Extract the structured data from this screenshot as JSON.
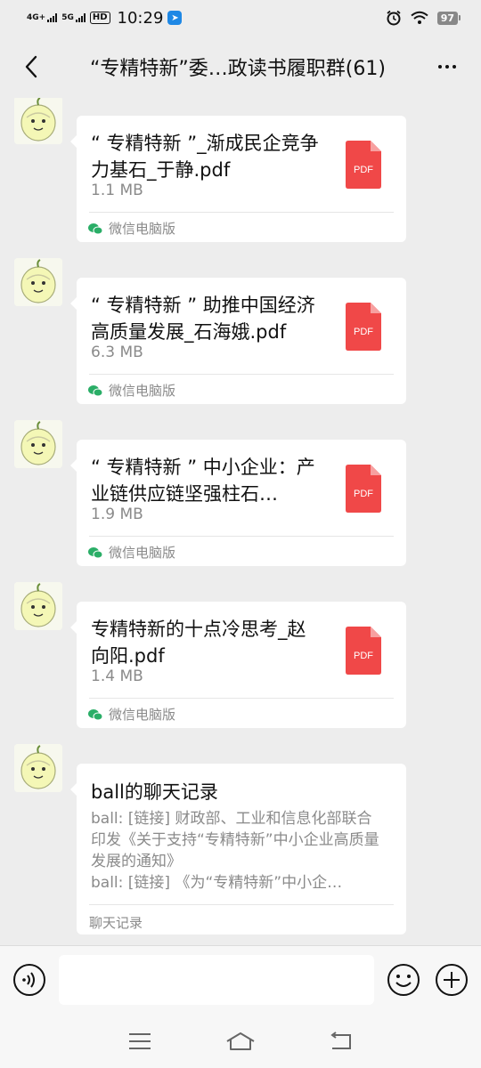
{
  "status_bar": {
    "sim1_label": "4G+",
    "sim2_label": "5G",
    "hd_label": "HD",
    "time": "10:29",
    "battery": "97"
  },
  "header": {
    "title": "“专精特新”委…政读书履职群(61)"
  },
  "messages": [
    {
      "type": "file",
      "file_name": "“ 专精特新 ”_渐成民企竞争力基石_于静.pdf",
      "file_size": "1.1 MB",
      "icon_label": "PDF",
      "source": "微信电脑版"
    },
    {
      "type": "file",
      "file_name": "“ 专精特新 ” 助推中国经济高质量发展_石海娥.pdf",
      "file_size": "6.3 MB",
      "icon_label": "PDF",
      "source": "微信电脑版"
    },
    {
      "type": "file",
      "file_name": "“ 专精特新 ” 中小企业：产业链供应链坚强柱石…",
      "file_size": "1.9 MB",
      "icon_label": "PDF",
      "source": "微信电脑版"
    },
    {
      "type": "file",
      "file_name": "专精特新的十点冷思考_赵向阳.pdf",
      "file_size": "1.4 MB",
      "icon_label": "PDF",
      "source": "微信电脑版"
    },
    {
      "type": "chat_record",
      "title": "ball的聊天记录",
      "lines": [
        "ball: [链接] 财政部、工业和信息化部联合印发《关于支持“专精特新”中小企业高质量发展的通知》",
        "ball: [链接] 《为“专精特新”中小企…"
      ],
      "footer": "聊天记录"
    }
  ],
  "input_bar": {
    "placeholder": ""
  },
  "icons": {
    "back": "chevron-left-icon",
    "more": "more-dots-icon",
    "voice": "voice-icon",
    "emoji": "emoji-icon",
    "plus": "plus-icon",
    "wechat": "wechat-icon"
  },
  "colors": {
    "background": "#ededed",
    "bubble": "#ffffff",
    "pdf_red": "#f04848",
    "wechat_green": "#2aae67"
  }
}
